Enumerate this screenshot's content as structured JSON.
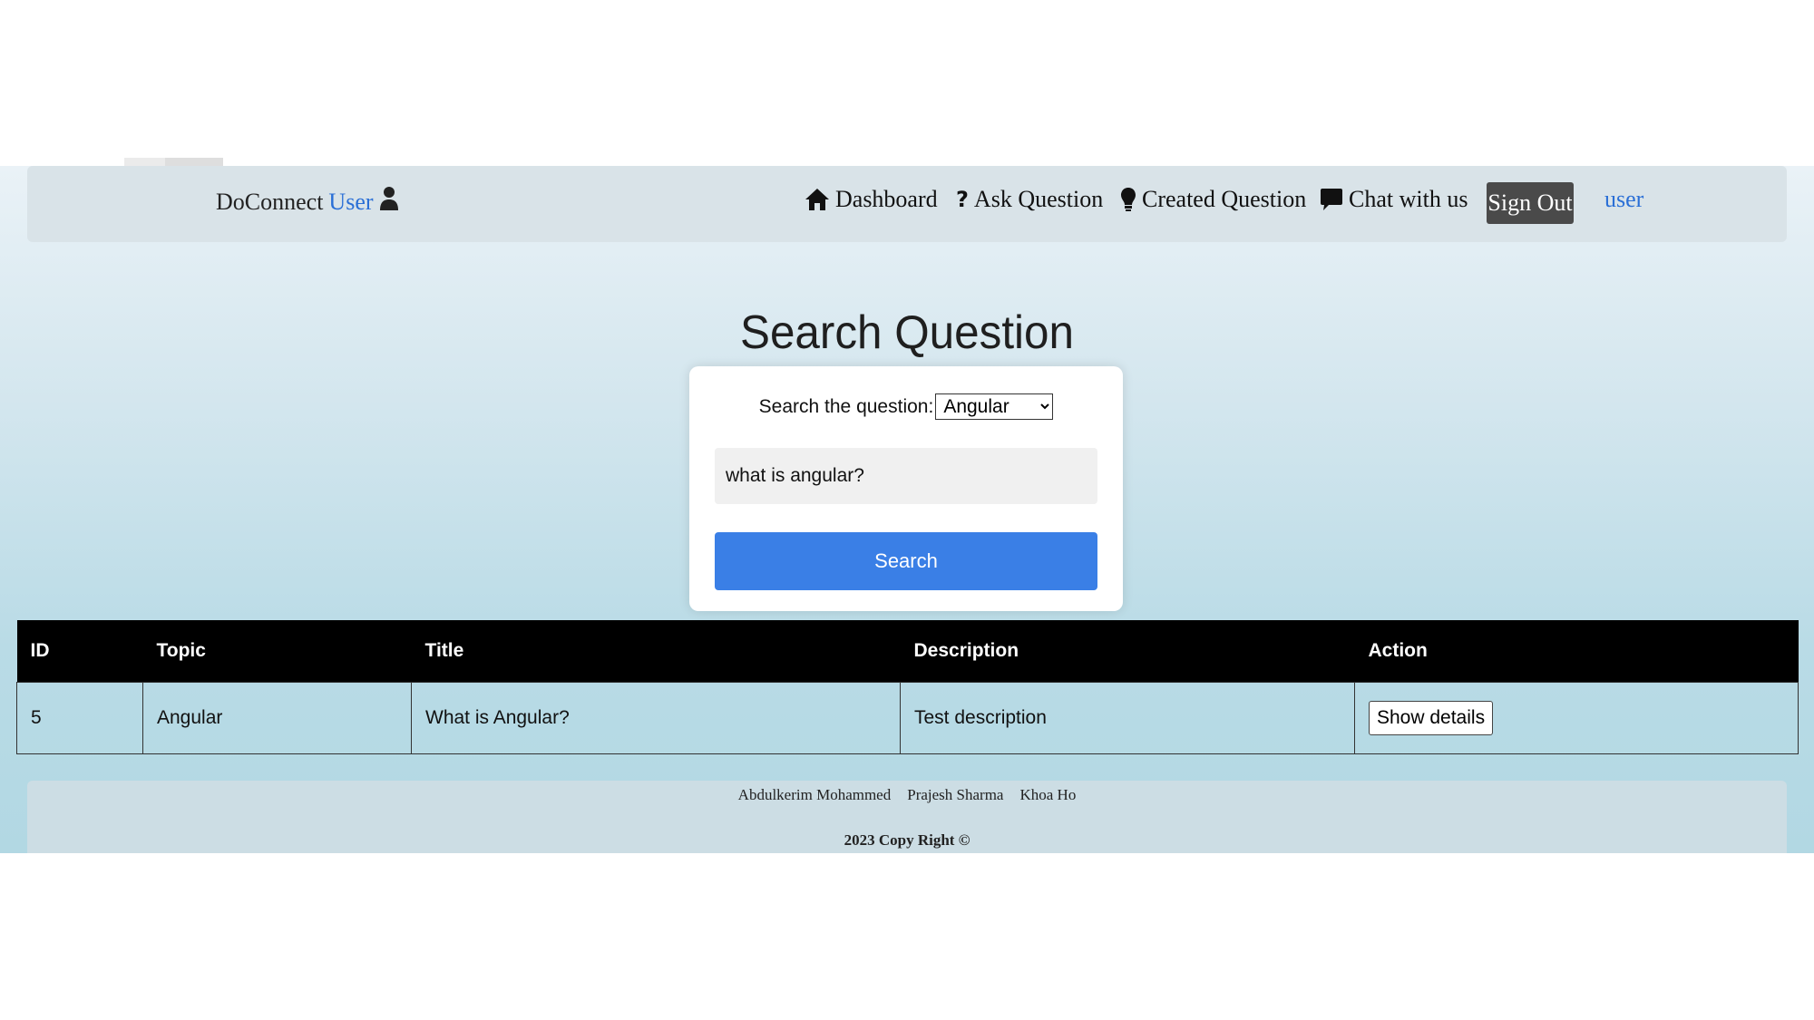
{
  "navbar": {
    "brand": "DoConnect",
    "brand_user": "User",
    "items": [
      {
        "label": "Dashboard",
        "icon": "home-icon"
      },
      {
        "label": "Ask Question",
        "icon": "question-icon"
      },
      {
        "label": "Created Question",
        "icon": "lightbulb-icon"
      },
      {
        "label": "Chat with us",
        "icon": "chat-icon"
      }
    ],
    "sign_out": "Sign Out",
    "user_link": "user"
  },
  "page": {
    "title": "Search Question"
  },
  "search": {
    "label": "Search the question:",
    "selected_topic": "Angular",
    "query_value": "what is angular?",
    "button": "Search"
  },
  "table": {
    "headers": [
      "ID",
      "Topic",
      "Title",
      "Description",
      "Action"
    ],
    "rows": [
      {
        "id": "5",
        "topic": "Angular",
        "title": "What is Angular?",
        "description": "Test description",
        "action": "Show details"
      }
    ]
  },
  "footer": {
    "authors": [
      "Abdulkerim Mohammed",
      "Prajesh Sharma",
      "Khoa Ho"
    ],
    "copyright": "2023 Copy Right ©"
  },
  "colors": {
    "link": "#2a6fd6",
    "primary_button": "#3a7fe6",
    "sign_out_bg": "#4a4a4a",
    "table_header_bg": "#000000"
  }
}
